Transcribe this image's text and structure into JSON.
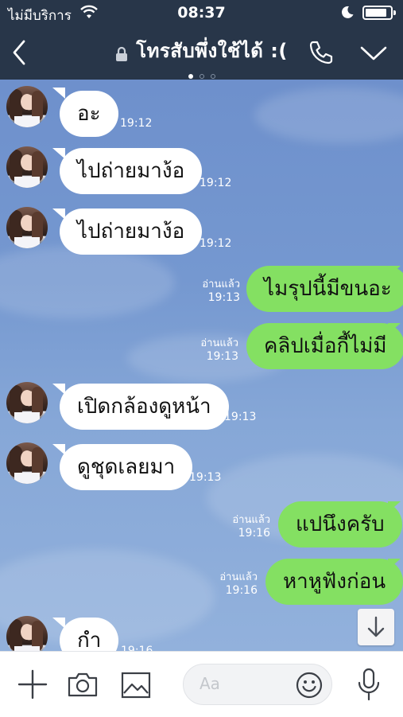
{
  "status_bar": {
    "carrier": "ไม่มีบริการ",
    "time": "08:37",
    "battery_level": 0.85
  },
  "nav": {
    "title": "โทรสับพึ่งใช้ได้ :(",
    "page_dots": 3,
    "active_dot": 1
  },
  "messages": [
    {
      "dir": "in",
      "text": "อะ",
      "time": "19:12"
    },
    {
      "dir": "in",
      "text": "ไปถ่ายมาง้อ",
      "time": "19:12"
    },
    {
      "dir": "in",
      "text": "ไปถ่ายมาง้อ",
      "time": "19:12"
    },
    {
      "dir": "out",
      "text": "ไมรุปนี้มีขนอะ",
      "time": "19:13",
      "read": "อ่านแล้ว"
    },
    {
      "dir": "out",
      "text": "คลิปเมื่อกี้ไม่มี",
      "time": "19:13",
      "read": "อ่านแล้ว"
    },
    {
      "dir": "in",
      "text": "เปิดกล้องดูหน้า",
      "time": "19:13"
    },
    {
      "dir": "in",
      "text": "ดูชุดเลยมา",
      "time": "19:13"
    },
    {
      "dir": "out",
      "text": "แปนึงครับ",
      "time": "19:16",
      "read": "อ่านแล้ว"
    },
    {
      "dir": "out",
      "text": "หาหูฟังก่อน",
      "time": "19:16",
      "read": "อ่านแล้ว"
    },
    {
      "dir": "in",
      "text": "กำ",
      "time": "19:16"
    }
  ],
  "input": {
    "placeholder": "Aa"
  },
  "icons": {
    "back": "chevron-left-icon",
    "lock": "lock-icon",
    "call": "phone-icon",
    "menu": "chevron-down-icon",
    "plus": "plus-icon",
    "camera": "camera-icon",
    "image": "image-icon",
    "emoji": "smiley-icon",
    "mic": "microphone-icon",
    "scroll": "arrow-down-icon"
  },
  "colors": {
    "header": "#283649",
    "outgoing_bubble": "#84e062",
    "incoming_bubble": "#ffffff",
    "chat_bg": "#7598d0"
  }
}
